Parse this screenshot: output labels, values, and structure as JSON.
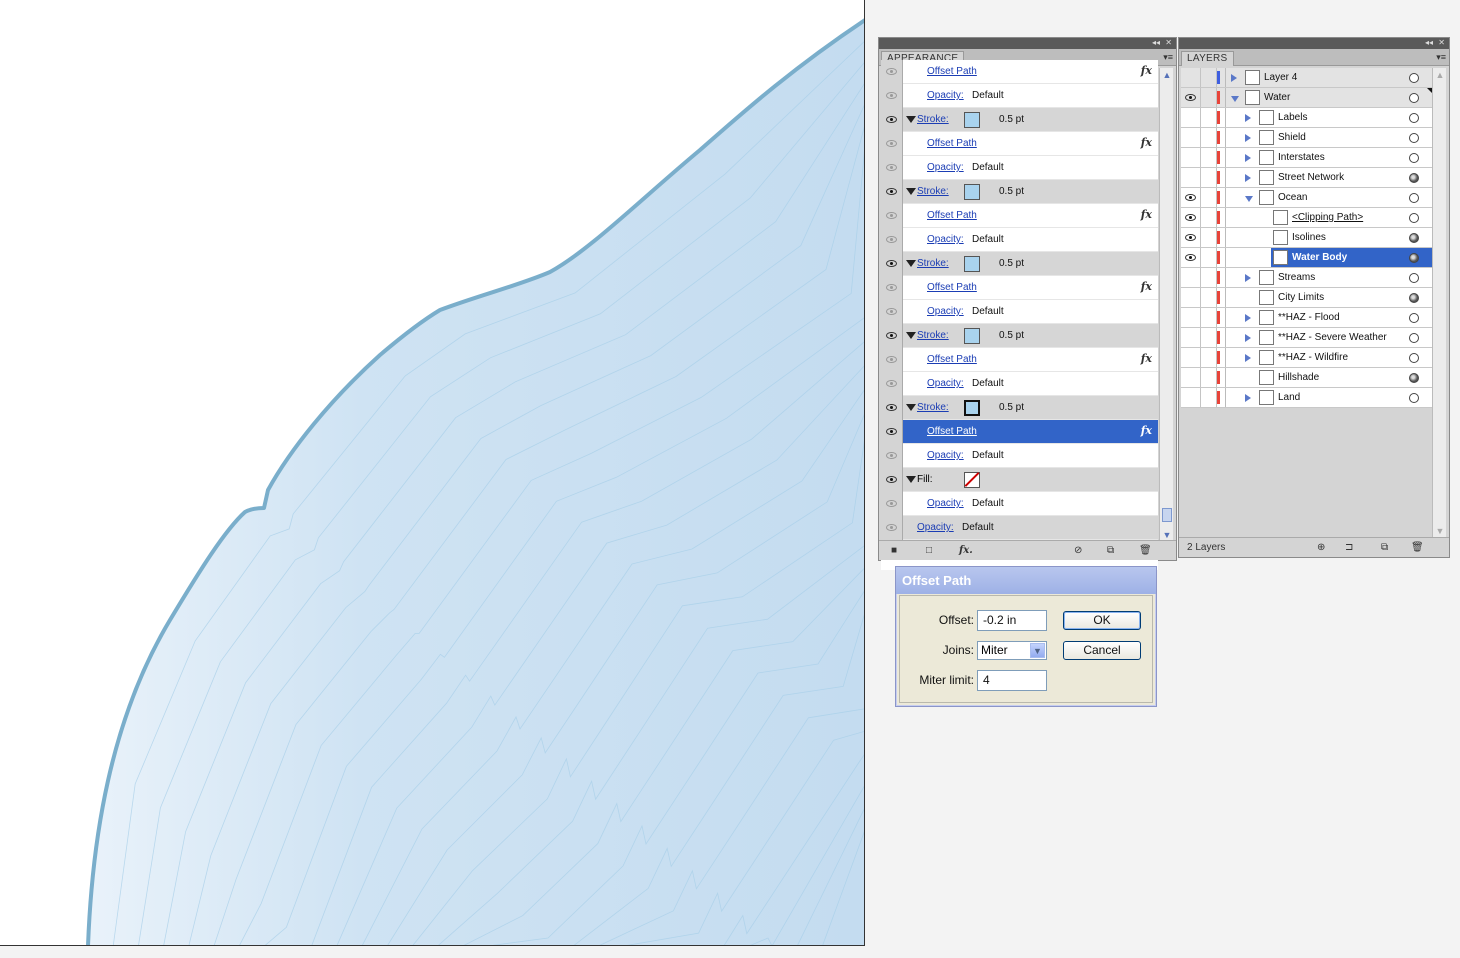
{
  "appearance_panel": {
    "tab": "APPEARANCE",
    "rows": [
      {
        "type": "effect",
        "label": "Offset Path",
        "fx": "fx",
        "eye": "dim"
      },
      {
        "type": "opacity",
        "label": "Opacity:",
        "value": "Default",
        "eye": "dim"
      },
      {
        "type": "stroke",
        "label": "Stroke:",
        "value": "0.5 pt",
        "eye": "on"
      },
      {
        "type": "effect",
        "label": "Offset Path",
        "fx": "fx",
        "eye": "dim"
      },
      {
        "type": "opacity",
        "label": "Opacity:",
        "value": "Default",
        "eye": "dim"
      },
      {
        "type": "stroke",
        "label": "Stroke:",
        "value": "0.5 pt",
        "eye": "on"
      },
      {
        "type": "effect",
        "label": "Offset Path",
        "fx": "fx",
        "eye": "dim"
      },
      {
        "type": "opacity",
        "label": "Opacity:",
        "value": "Default",
        "eye": "dim"
      },
      {
        "type": "stroke",
        "label": "Stroke:",
        "value": "0.5 pt",
        "eye": "on"
      },
      {
        "type": "effect",
        "label": "Offset Path",
        "fx": "fx",
        "eye": "dim"
      },
      {
        "type": "opacity",
        "label": "Opacity:",
        "value": "Default",
        "eye": "dim"
      },
      {
        "type": "stroke",
        "label": "Stroke:",
        "value": "0.5 pt",
        "eye": "on"
      },
      {
        "type": "effect",
        "label": "Offset Path",
        "fx": "fx",
        "eye": "dim"
      },
      {
        "type": "opacity",
        "label": "Opacity:",
        "value": "Default",
        "eye": "dim"
      },
      {
        "type": "stroke",
        "label": "Stroke:",
        "value": "0.5 pt",
        "eye": "on",
        "swatch_selected": true
      },
      {
        "type": "effect",
        "label": "Offset Path",
        "fx": "fx",
        "eye": "on",
        "selected": true
      },
      {
        "type": "opacity",
        "label": "Opacity:",
        "value": "Default",
        "eye": "dim"
      },
      {
        "type": "fill",
        "label": "Fill:",
        "eye": "on"
      },
      {
        "type": "opacity",
        "label": "Opacity:",
        "value": "Default",
        "eye": "dim"
      },
      {
        "type": "object-opacity",
        "label": "Opacity:",
        "value": "Default",
        "eye": "dim"
      }
    ]
  },
  "layers_panel": {
    "tab": "LAYERS",
    "count": "2 Layers",
    "rows": [
      {
        "name": "Layer 4",
        "level": 0,
        "expand": "closed",
        "eye": false,
        "color": "blue",
        "target": "empty",
        "top": true
      },
      {
        "name": "Water",
        "level": 0,
        "expand": "open",
        "eye": true,
        "color": "red",
        "target": "empty",
        "top": true,
        "corner": true
      },
      {
        "name": "Labels",
        "level": 1,
        "expand": "closed",
        "eye": false,
        "color": "red",
        "target": "empty"
      },
      {
        "name": "Shield",
        "level": 1,
        "expand": "closed",
        "eye": false,
        "color": "red",
        "target": "empty"
      },
      {
        "name": "Interstates",
        "level": 1,
        "expand": "closed",
        "eye": false,
        "color": "red",
        "target": "empty"
      },
      {
        "name": "Street Network",
        "level": 1,
        "expand": "closed",
        "eye": false,
        "color": "red",
        "target": "filled"
      },
      {
        "name": "Ocean",
        "level": 1,
        "expand": "open",
        "eye": true,
        "color": "red",
        "target": "empty"
      },
      {
        "name": "<Clipping Path>",
        "level": 2,
        "expand": "none",
        "eye": true,
        "color": "red",
        "target": "empty",
        "underline": true
      },
      {
        "name": "Isolines",
        "level": 2,
        "expand": "none",
        "eye": true,
        "color": "red",
        "target": "filled"
      },
      {
        "name": "Water Body",
        "level": 2,
        "expand": "none",
        "eye": true,
        "color": "red",
        "target": "filled",
        "selected": true
      },
      {
        "name": "Streams",
        "level": 1,
        "expand": "closed",
        "eye": false,
        "color": "red",
        "target": "empty"
      },
      {
        "name": "City Limits",
        "level": 1,
        "expand": "none",
        "eye": false,
        "color": "red",
        "target": "filled"
      },
      {
        "name": "**HAZ - Flood",
        "level": 1,
        "expand": "closed",
        "eye": false,
        "color": "red",
        "target": "empty"
      },
      {
        "name": "**HAZ - Severe Weather",
        "level": 1,
        "expand": "closed",
        "eye": false,
        "color": "red",
        "target": "empty"
      },
      {
        "name": "**HAZ - Wildfire",
        "level": 1,
        "expand": "closed",
        "eye": false,
        "color": "red",
        "target": "empty"
      },
      {
        "name": "Hillshade",
        "level": 1,
        "expand": "none",
        "eye": false,
        "color": "red",
        "target": "filled"
      },
      {
        "name": "Land",
        "level": 1,
        "expand": "closed",
        "eye": false,
        "color": "red",
        "target": "empty"
      }
    ]
  },
  "offset_dialog": {
    "title": "Offset Path",
    "offset_label": "Offset:",
    "offset_value": "-0.2 in",
    "joins_label": "Joins:",
    "joins_value": "Miter",
    "miter_label": "Miter limit:",
    "miter_value": "4",
    "ok_label": "OK",
    "cancel_label": "Cancel"
  },
  "colors": {
    "water_fill": "#c7dff2",
    "water_stroke": "#7aaecb",
    "isoline": "#a6cfe8",
    "selection": "#3264c8"
  }
}
